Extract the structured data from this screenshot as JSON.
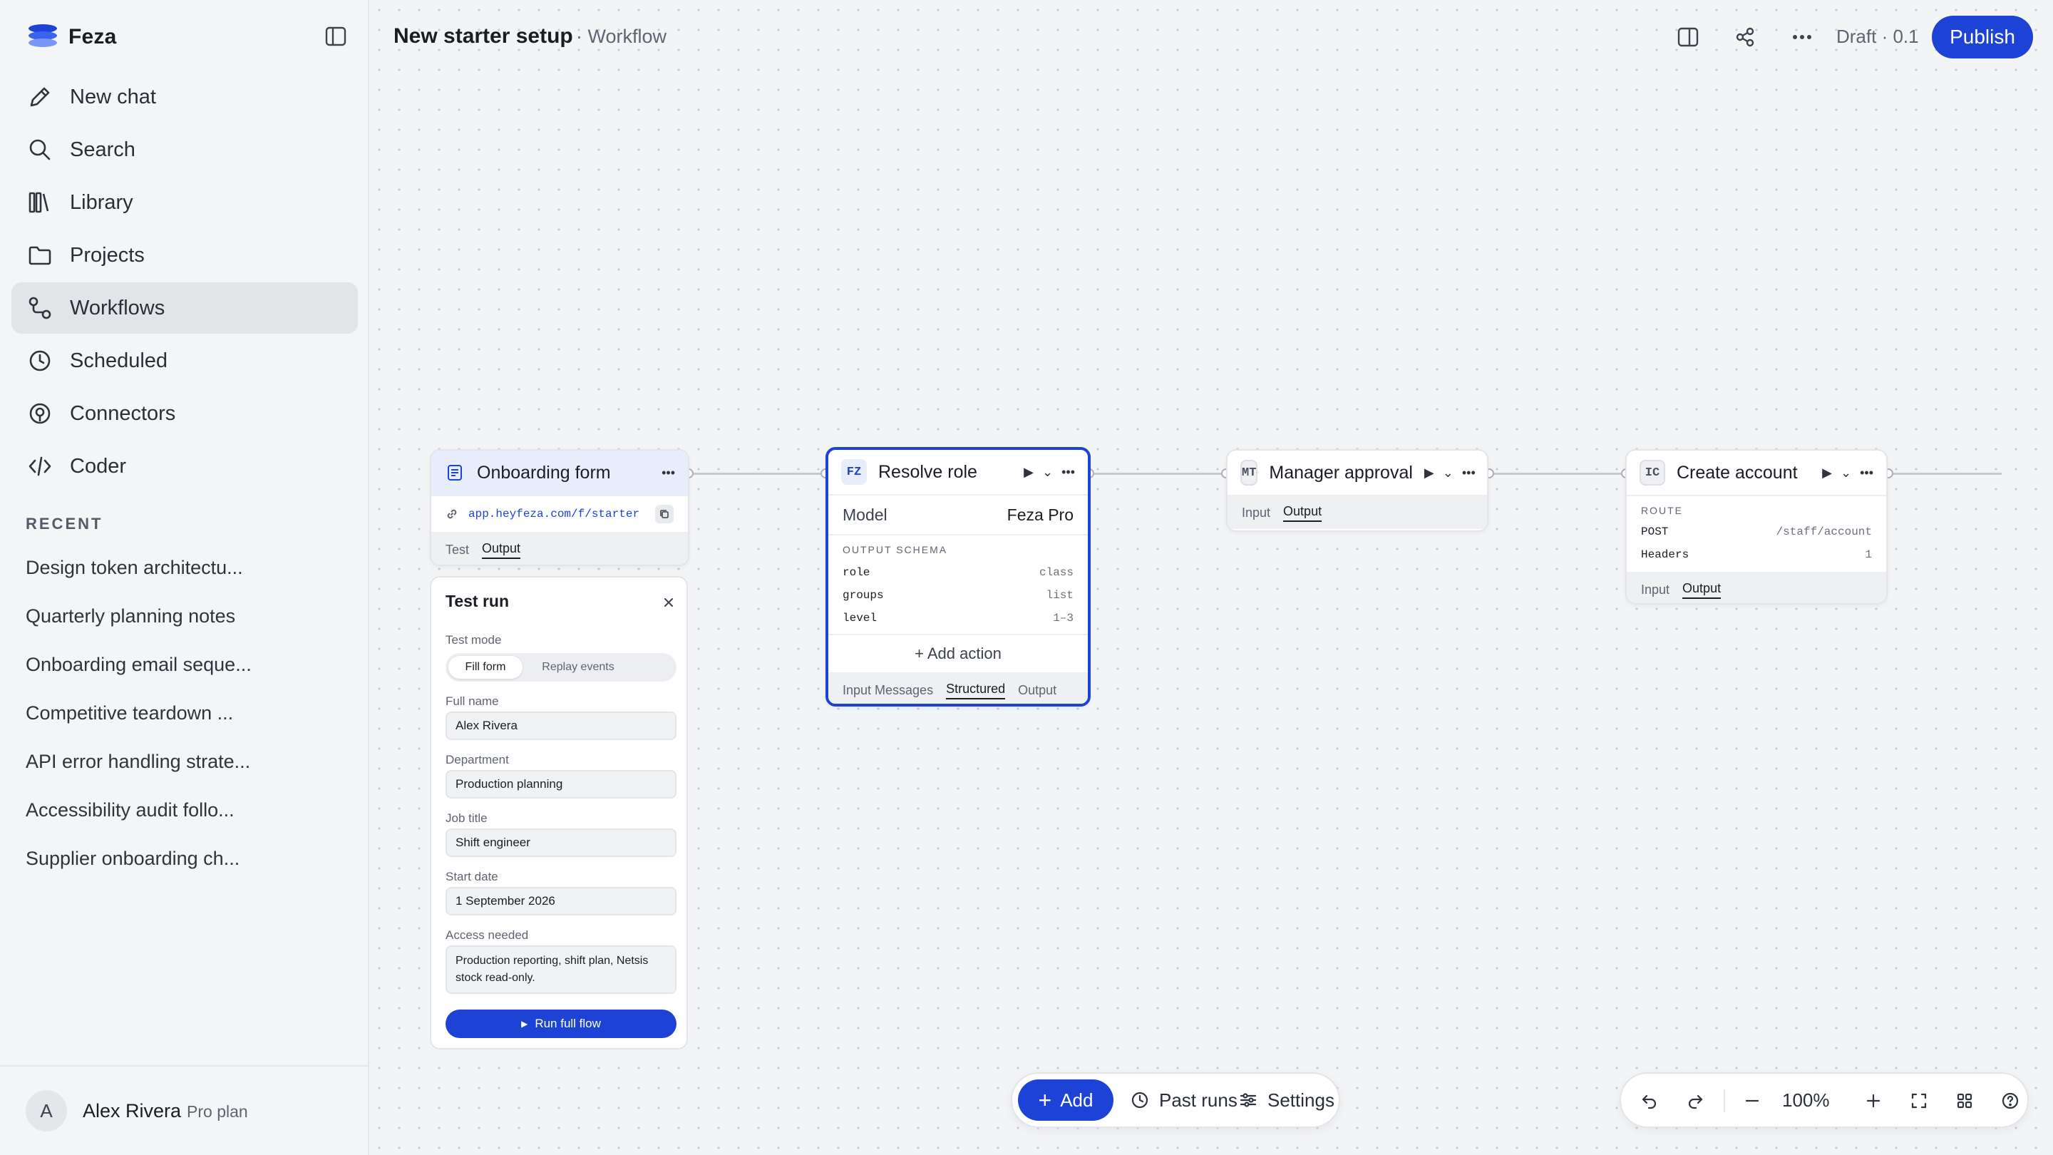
{
  "app": {
    "name": "Feza"
  },
  "nav": [
    {
      "label": "New chat",
      "icon": "pencil-icon"
    },
    {
      "label": "Search",
      "icon": "search-icon"
    },
    {
      "label": "Library",
      "icon": "library-icon"
    },
    {
      "label": "Projects",
      "icon": "folder-icon"
    },
    {
      "label": "Workflows",
      "icon": "workflow-icon",
      "active": true
    },
    {
      "label": "Scheduled",
      "icon": "clock-icon"
    },
    {
      "label": "Connectors",
      "icon": "connector-icon"
    },
    {
      "label": "Coder",
      "icon": "code-icon"
    }
  ],
  "recent": {
    "heading": "RECENT",
    "items": [
      "Design token architectu...",
      "Quarterly planning notes",
      "Onboarding email seque...",
      "Competitive teardown ...",
      "API error handling strate...",
      "Accessibility audit follo...",
      "Supplier onboarding ch..."
    ]
  },
  "user": {
    "initial": "A",
    "name": "Alex Rivera",
    "plan": "Pro plan"
  },
  "header": {
    "title": "New starter setup",
    "crumb": "· Workflow",
    "draft": "Draft · 0.1",
    "publish": "Publish"
  },
  "nodes": {
    "form": {
      "title": "Onboarding form",
      "url": "app.heyfeza.com/f/starter",
      "tabs": [
        "Test",
        "Output"
      ]
    },
    "resolve": {
      "badge": "FZ",
      "title": "Resolve role",
      "model_label": "Model",
      "model_value": "Feza Pro",
      "schema_label": "OUTPUT SCHEMA",
      "schema": [
        {
          "key": "role",
          "type": "class"
        },
        {
          "key": "groups",
          "type": "list"
        },
        {
          "key": "level",
          "type": "1–3"
        }
      ],
      "add_action": "+ Add action",
      "tabs": [
        "Input Messages",
        "Structured",
        "Output"
      ]
    },
    "approval": {
      "badge": "MT",
      "title": "Manager approval",
      "tabs": [
        "Input",
        "Output"
      ]
    },
    "account": {
      "badge": "IC",
      "title": "Create account",
      "route_label": "ROUTE",
      "method": "POST",
      "path": "/staff/account",
      "headers_label": "Headers",
      "headers_count": "1",
      "tabs": [
        "Input",
        "Output"
      ]
    }
  },
  "test_panel": {
    "title": "Test run",
    "mode_label": "Test mode",
    "modes": [
      "Fill form",
      "Replay events"
    ],
    "fields": [
      {
        "label": "Full name",
        "value": "Alex Rivera"
      },
      {
        "label": "Department",
        "value": "Production planning"
      },
      {
        "label": "Job title",
        "value": "Shift engineer"
      },
      {
        "label": "Start date",
        "value": "1 September 2026"
      }
    ],
    "access_label": "Access needed",
    "access_value": "Production reporting, shift plan, Netsis stock read-only.",
    "run": "Run full flow"
  },
  "bottom_bar": {
    "add": "Add",
    "past_runs": "Past runs",
    "settings": "Settings"
  },
  "zoom": {
    "level": "100%"
  },
  "colors": {
    "accent": "#1d43d6",
    "sidebar_active": "#e2e4e8"
  }
}
